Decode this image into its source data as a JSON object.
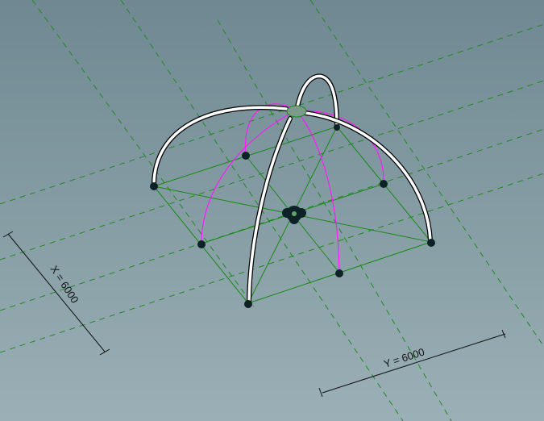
{
  "dimensions": {
    "x_label": "X = 6000",
    "y_label": "Y = 6000"
  },
  "colors": {
    "grid": "#1f8a1f",
    "mesh": "#178a17",
    "arc": "#ff19ff",
    "arch": "#ffffff"
  }
}
